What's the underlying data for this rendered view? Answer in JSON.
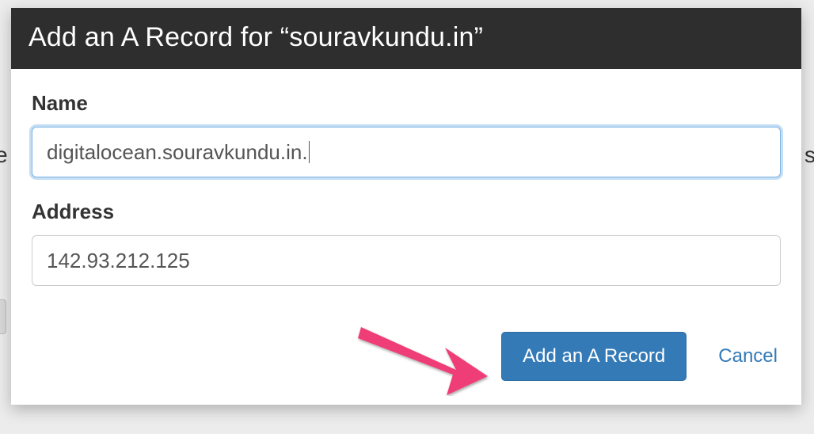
{
  "modal": {
    "title": "Add an A Record for “souravkundu.in”",
    "fields": {
      "name": {
        "label": "Name",
        "value": "digitalocean.souravkundu.in."
      },
      "address": {
        "label": "Address",
        "value": "142.93.212.125"
      }
    },
    "actions": {
      "primary": "Add an A Record",
      "cancel": "Cancel"
    }
  },
  "background": {
    "left_char": "e",
    "right_char": "s"
  }
}
